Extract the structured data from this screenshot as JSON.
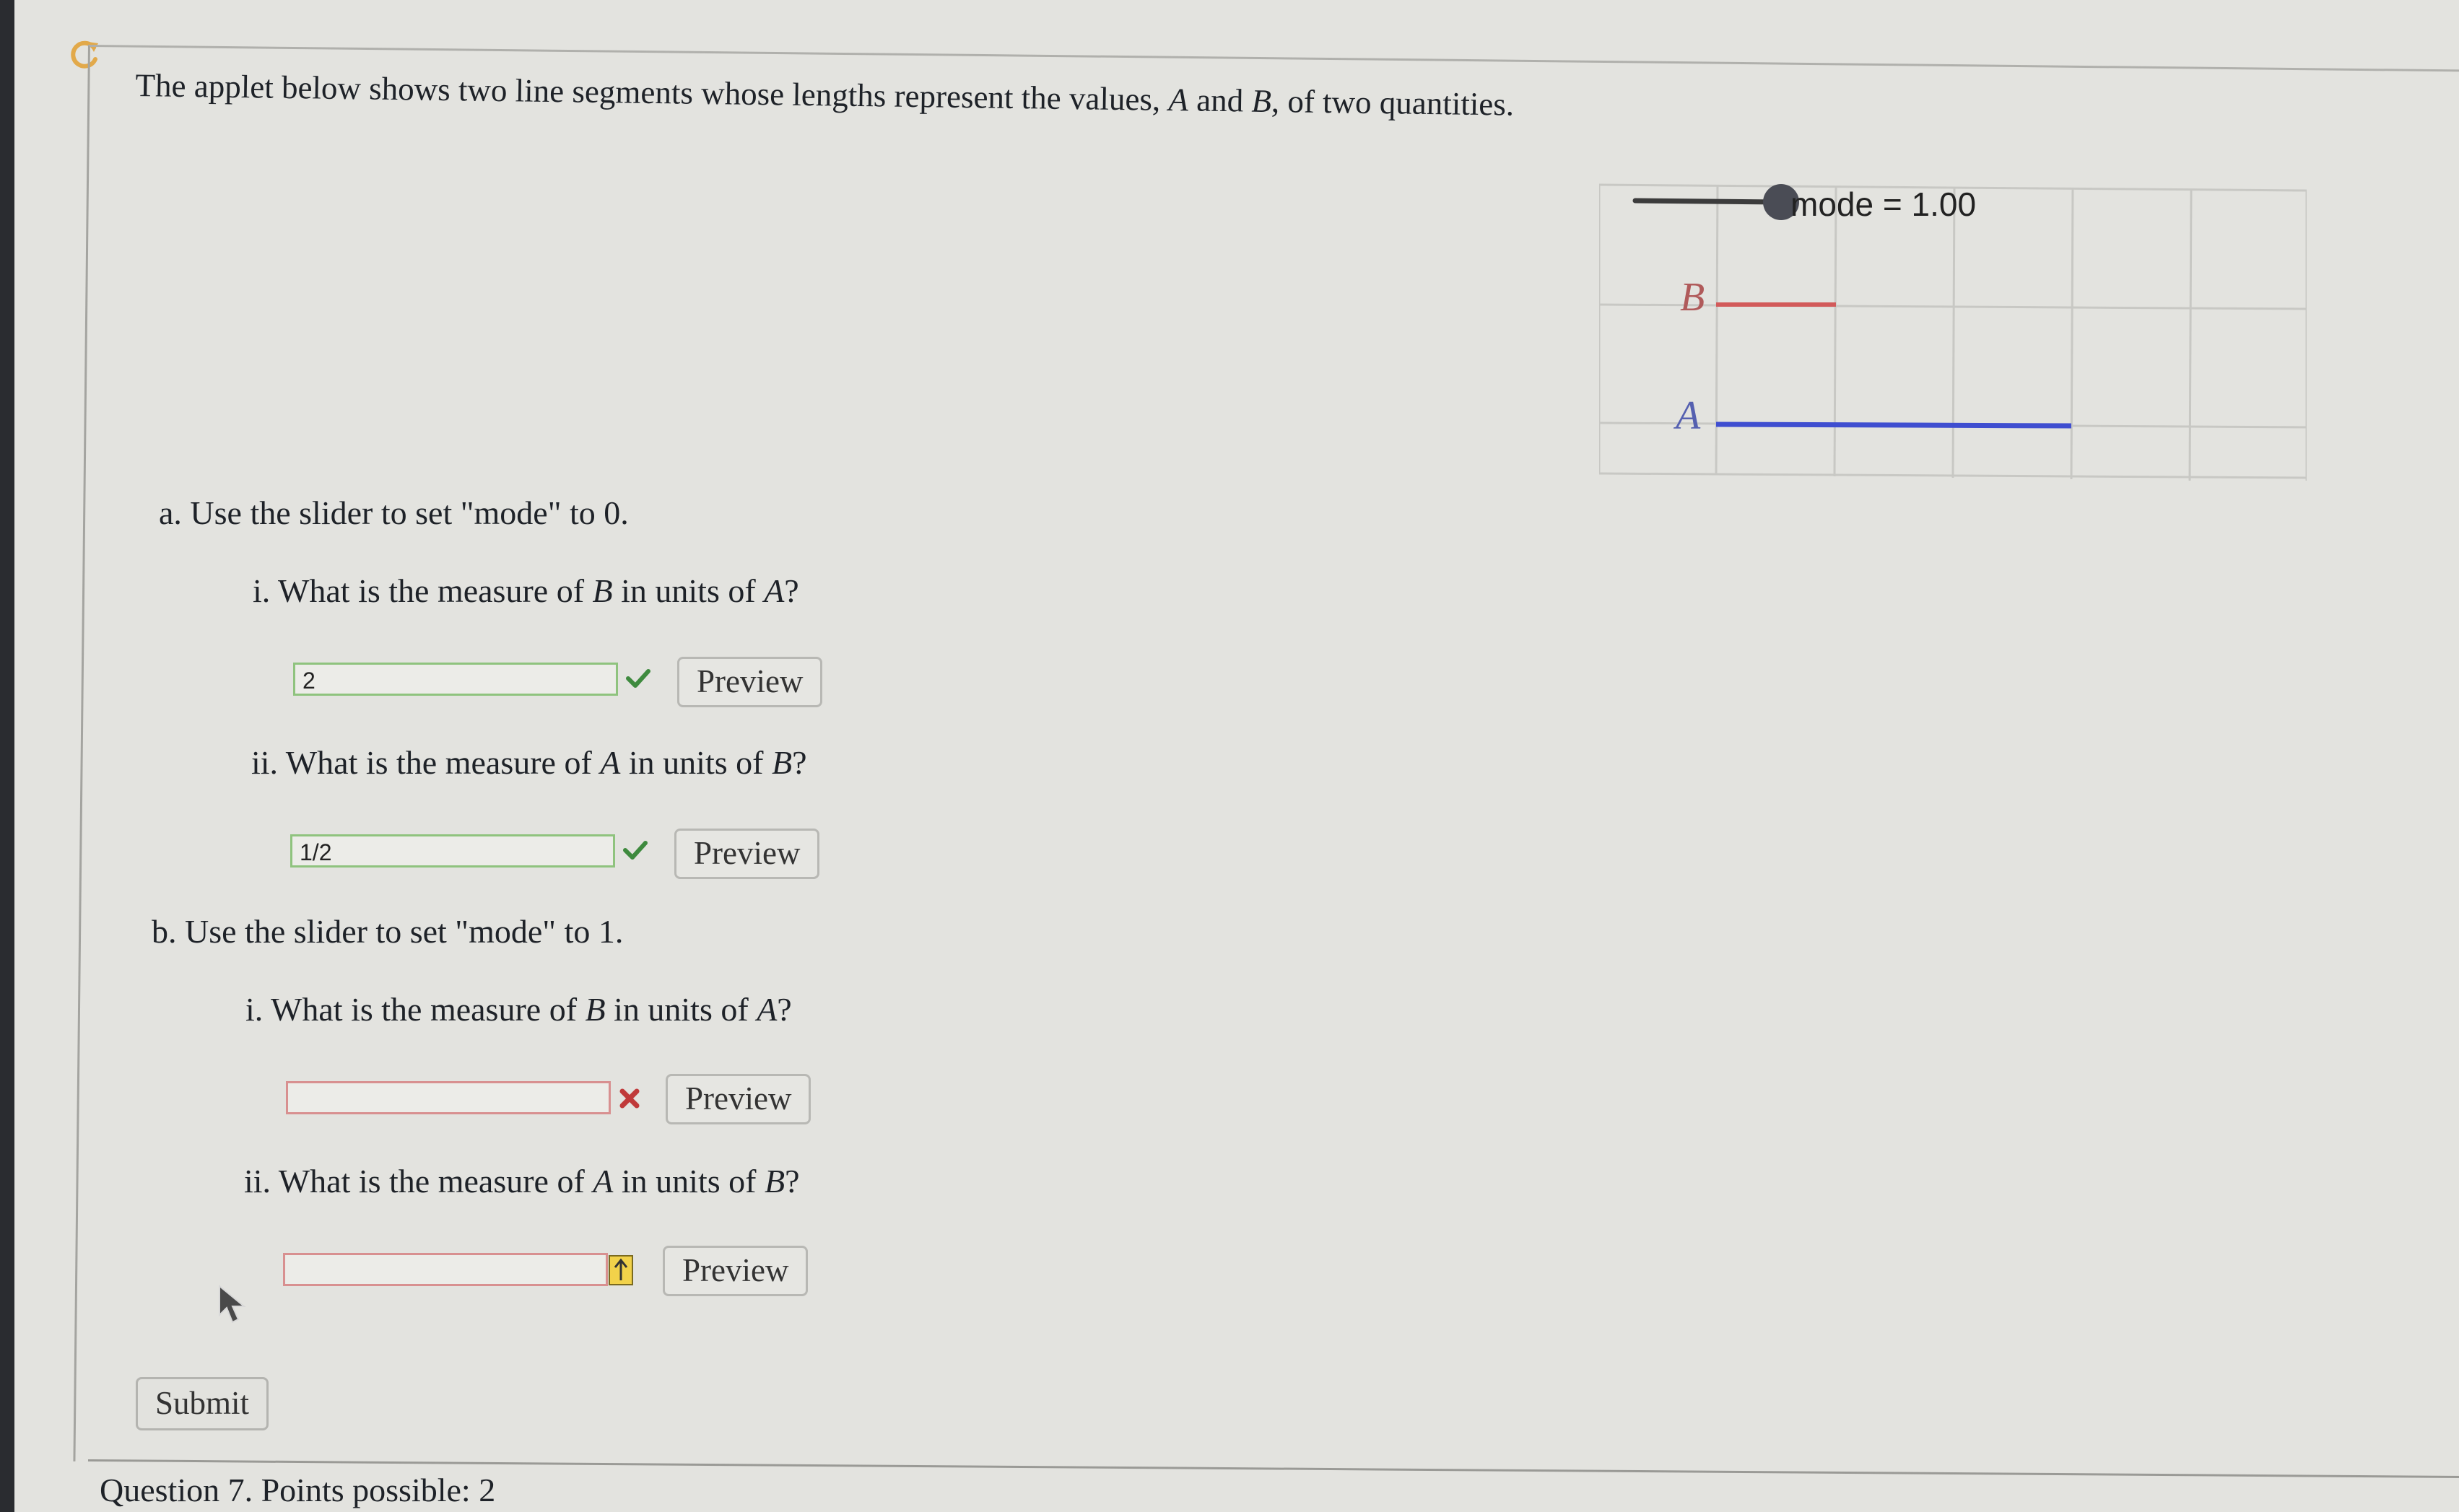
{
  "intro": {
    "before_a": "The applet below shows two line segments whose lengths represent the values, ",
    "var_a": "A",
    "between": " and ",
    "var_b": "B",
    "after_b": ", of two quantities."
  },
  "applet": {
    "slider_readout": "mode = 1.00",
    "label_b": "B",
    "label_a": "A",
    "colors": {
      "segment_b": "#d25a5a",
      "segment_a": "#3f4ed0",
      "grid": "#c8c8c4",
      "slider_track": "#3c3c3c",
      "slider_thumb": "#4a4c55"
    }
  },
  "part_a": {
    "label": "a.",
    "instruction": "Use the slider to set \"mode\" to 0.",
    "q1": {
      "marker": "i.",
      "text_1": "What is the measure of ",
      "var_1": "B",
      "text_2": " in units of ",
      "var_2": "A",
      "text_3": "?",
      "answer": "2",
      "status": "correct",
      "preview_label": "Preview"
    },
    "q2": {
      "marker": "ii.",
      "text_1": "What is the measure of ",
      "var_1": "A",
      "text_2": " in units of ",
      "var_2": "B",
      "text_3": "?",
      "answer": "1/2",
      "status": "correct",
      "preview_label": "Preview"
    }
  },
  "part_b": {
    "label": "b.",
    "instruction": "Use the slider to set \"mode\" to 1.",
    "q1": {
      "marker": "i.",
      "text_1": "What is the measure of ",
      "var_1": "B",
      "text_2": " in units of ",
      "var_2": "A",
      "text_3": "?",
      "answer": "",
      "status": "incorrect",
      "preview_label": "Preview"
    },
    "q2": {
      "marker": "ii.",
      "text_1": "What is the measure of ",
      "var_1": "A",
      "text_2": " in units of ",
      "var_2": "B",
      "text_3": "?",
      "answer": "",
      "status": "attention",
      "preview_label": "Preview"
    }
  },
  "submit_label": "Submit",
  "next_question": "Question 7. Points possible: 2",
  "icons": [
    "refresh-icon",
    "correct-check-icon",
    "incorrect-x-icon",
    "attention-arrow-icon",
    "mouse-cursor-icon"
  ]
}
